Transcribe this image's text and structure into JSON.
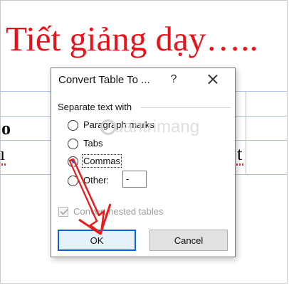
{
  "document": {
    "title": "Tiết giảng dạy…..",
    "fragment_left_top": "o",
    "fragment_left_bottom": "ı",
    "fragment_right": "t"
  },
  "dialog": {
    "title": "Convert Table To ...",
    "help": "?",
    "section_label": "Separate text with",
    "options": [
      {
        "label": "Paragraph marks",
        "checked": false
      },
      {
        "label": "Tabs",
        "checked": false
      },
      {
        "label": "Commas",
        "checked": true
      },
      {
        "label": "Other:",
        "checked": false
      }
    ],
    "other_value": "-",
    "checkbox_label": "Convert nested tables",
    "ok_label": "OK",
    "cancel_label": "Cancel"
  },
  "watermark": {
    "text": "uantrimang"
  },
  "colors": {
    "title_red": "#e8131a",
    "accent_blue": "#0a64d8",
    "arrow_red": "#e81c1c"
  }
}
